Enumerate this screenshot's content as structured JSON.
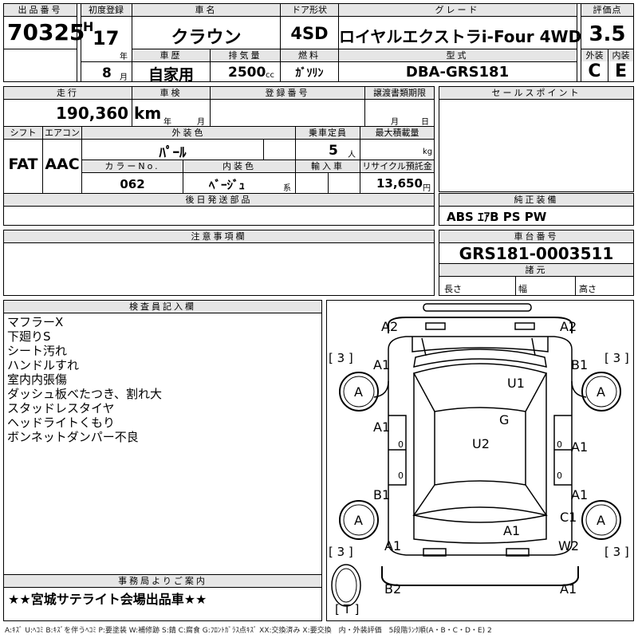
{
  "header": {
    "lot_label": "出品番号",
    "lot_number": "70325",
    "first_reg_label": "初度登録",
    "era": "H",
    "year": "17",
    "year_unit": "年",
    "month": "8",
    "month_unit": "月",
    "car_name_label": "車名",
    "car_name": "クラウン",
    "door_label": "ドア形状",
    "door": "4SD",
    "grade_label": "グレード",
    "grade": "ロイヤルエクストラi-Four 4WD",
    "score_label": "評価点",
    "score": "3.5",
    "history_label": "車歴",
    "history": "自家用",
    "displacement_label": "排気量",
    "displacement": "2500",
    "displacement_unit": "cc",
    "fuel_label": "燃料",
    "fuel": "ｶﾞｿﾘﾝ",
    "model_label": "型式",
    "model": "DBA-GRS181",
    "exterior_label": "外装",
    "exterior": "C",
    "interior_label": "内装",
    "interior": "E"
  },
  "row2": {
    "mileage_label": "走行",
    "mileage": "190,360 km",
    "inspection_label": "車検",
    "inspection_year_unit": "年",
    "inspection_month_unit": "月",
    "reg_no_label": "登録番号",
    "transfer_label": "譲渡書類期限",
    "transfer_month_unit": "月",
    "transfer_day_unit": "日",
    "shift_label": "シフト",
    "shift": "FAT",
    "ac_label": "エアコン",
    "ac": "AAC",
    "ext_color_label": "外装色",
    "ext_color": "ﾊﾟｰﾙ",
    "capacity_label": "乗車定員",
    "capacity": "5",
    "capacity_unit": "人",
    "max_load_label": "最大積載量",
    "max_load_unit": "kg",
    "color_no_label": "カラーNo.",
    "color_no": "062",
    "int_color_label": "内装色",
    "int_color": "ﾍﾞｰｼﾞｭ",
    "int_color_suffix": "系",
    "import_label": "輸入車",
    "recycle_label": "リサイクル預託金",
    "recycle": "13,650",
    "recycle_unit": "円",
    "later_parts_label": "後日発送部品"
  },
  "sales_points": {
    "label": "セールスポイント"
  },
  "genuine": {
    "label": "純正装備",
    "value": "ABS ｴｱB PS PW"
  },
  "caution": {
    "label": "注意事項欄"
  },
  "chassis": {
    "label": "車台番号",
    "value": "GRS181-0003511",
    "specs_label": "諸元",
    "length_label": "長さ",
    "width_label": "幅",
    "height_label": "高さ"
  },
  "inspector": {
    "label": "検査員記入欄",
    "lines": [
      "マフラーX",
      "下廻りS",
      "シート汚れ",
      "ハンドルすれ",
      "室内内張傷",
      "ダッシュ板べたつき、割れ大",
      "スタッドレスタイヤ",
      "ヘッドライトくもり",
      "ボンネットダンパー不良"
    ]
  },
  "office": {
    "label": "事務局よりご案内",
    "value": "★★宮城サテライト会場出品車★★"
  },
  "diagram_marks": {
    "a2_left": "A2",
    "a2_right": "A2",
    "tire_fl": "[ 3 ]",
    "tire_fr": "[ 3 ]",
    "tire_rl": "[ 3 ]",
    "tire_rr": "[ 3 ]",
    "spare": "[ T ]",
    "a1_fl": "A1",
    "b1_fr": "B1",
    "wheel_fl": "A",
    "wheel_fr": "A",
    "wheel_rl": "A",
    "wheel_rr": "A",
    "u1": "U1",
    "g": "G",
    "u2": "U2",
    "a1_ld1": "A1",
    "a1_rd1": "A1",
    "b1_ld2": "B1",
    "a1_rd2": "A1",
    "c1": "C1",
    "a1_roof": "A1",
    "a1_rl": "A1",
    "w2": "W2",
    "b2": "B2",
    "a1_rear": "A1",
    "zero_l1": "0",
    "zero_r1": "0",
    "zero_l2": "0",
    "zero_r2": "0"
  },
  "legend": "A:ｷｽﾞ U:ﾍｺﾐ B:ｷｽﾞを伴うﾍｺﾐ P:要塗装 W:補修跡 S:錆 C:腐食 G:ﾌﾛﾝﾄｶﾞﾗｽ点ｷｽﾞ XX:交換済み X:要交換　内・外装評価　5段階ﾗﾝｸ順(A・B・C・D・E) 2"
}
